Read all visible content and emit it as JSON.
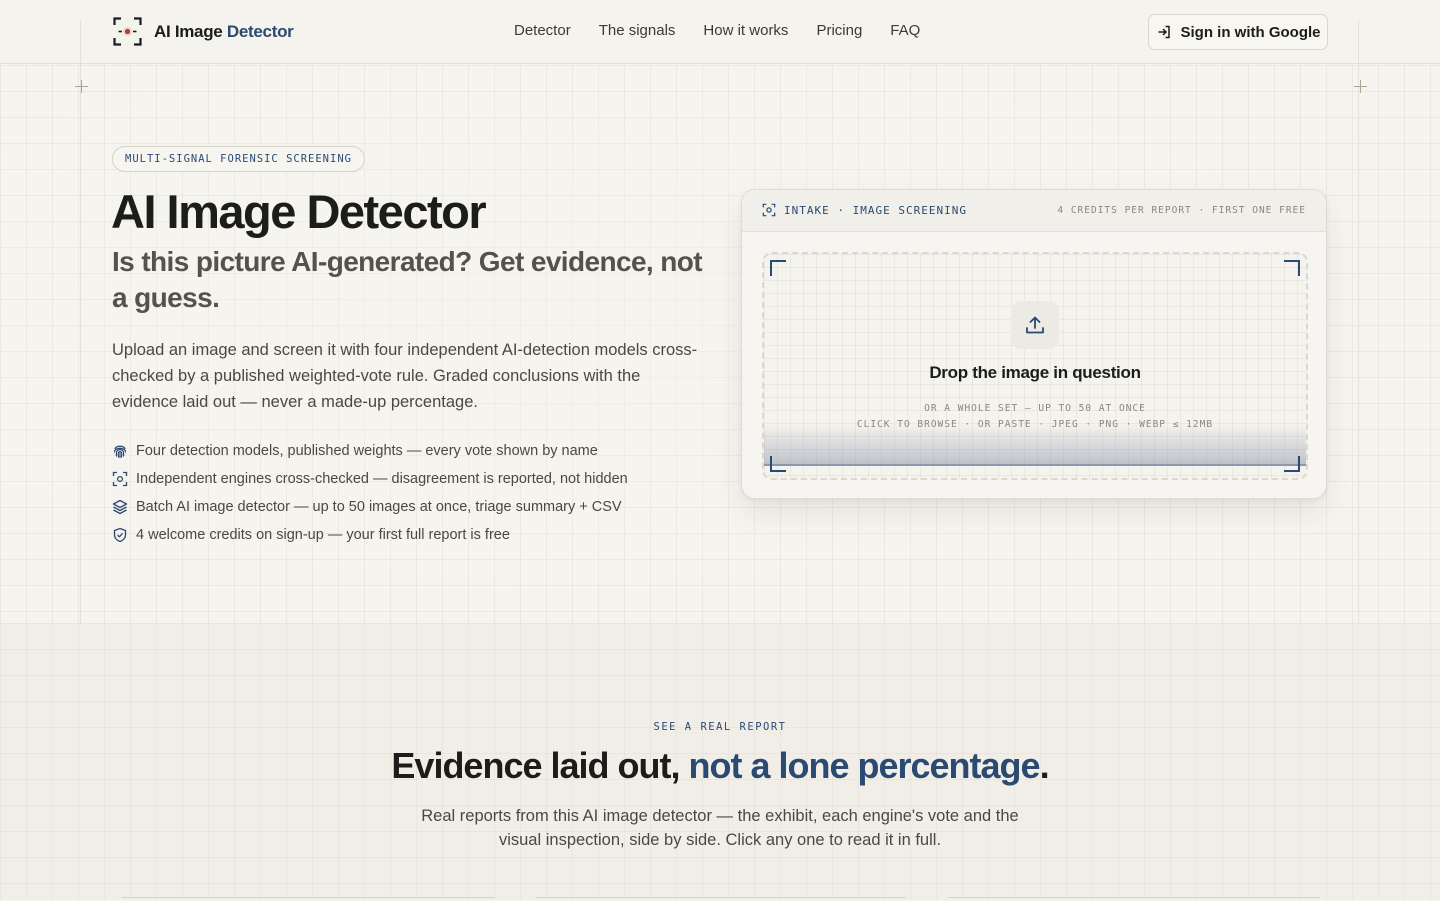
{
  "header": {
    "brand_main": "AI Image",
    "brand_accent": "Detector",
    "nav": [
      "Detector",
      "The signals",
      "How it works",
      "Pricing",
      "FAQ"
    ],
    "signin_label": "Sign in with Google"
  },
  "hero": {
    "tag": "MULTI-SIGNAL FORENSIC SCREENING",
    "title": "AI Image Detector",
    "subtitle": "Is this picture AI-generated? Get evidence, not a guess.",
    "lead": "Upload an image and screen it with four independent AI-detection models cross-checked by a published weighted-vote rule. Graded conclusions with the evidence laid out — never a made-up percentage.",
    "features": [
      {
        "icon": "fingerprint-icon",
        "text": "Four detection models, published weights — every vote shown by name"
      },
      {
        "icon": "scan-icon",
        "text": "Independent engines cross-checked — disagreement is reported, not hidden"
      },
      {
        "icon": "layers-icon",
        "text": "Batch AI image detector — up to 50 images at once, triage summary + CSV"
      },
      {
        "icon": "shield-check-icon",
        "text": "4 welcome credits on sign-up — your first full report is free"
      }
    ]
  },
  "intake": {
    "title": "INTAKE · IMAGE SCREENING",
    "meta": "4 CREDITS PER REPORT · FIRST ONE FREE",
    "drop_title": "Drop the image in question",
    "drop_line1": "OR A WHOLE SET — UP TO 50 AT ONCE",
    "drop_line2": "CLICK TO BROWSE · OR PASTE · JPEG · PNG · WEBP ≤ 12MB"
  },
  "report_section": {
    "eyebrow": "SEE A REAL REPORT",
    "title_main": "Evidence laid out, ",
    "title_accent": "not a lone percentage",
    "title_end": ".",
    "subtitle": "Real reports from this AI image detector — the exhibit, each engine's vote and the visual inspection, side by side. Click any one to read it in full."
  },
  "colors": {
    "accent": "#2a4a72",
    "background": "#f5f3ee",
    "logo_dot": "#c0392b"
  }
}
